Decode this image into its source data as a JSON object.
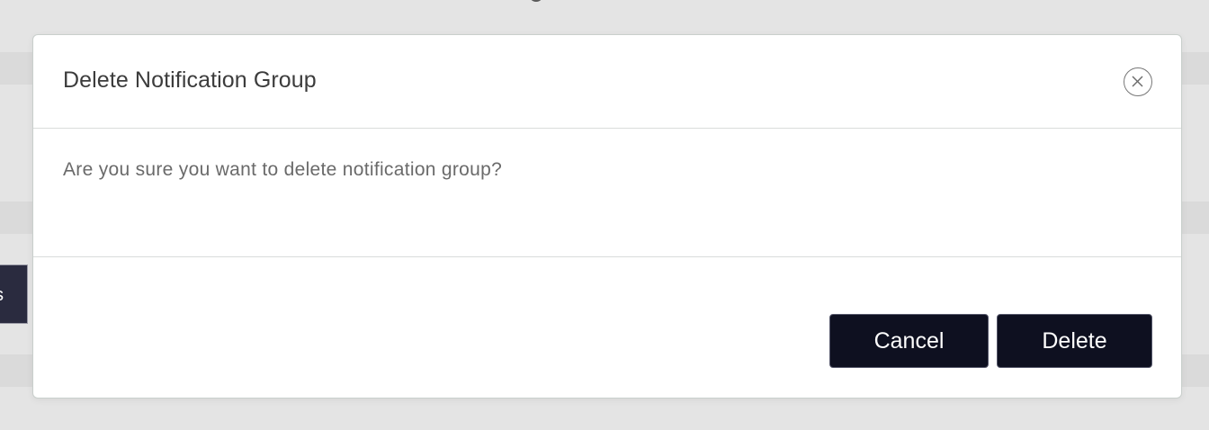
{
  "background": {
    "side_button_label": "s"
  },
  "dialog": {
    "title": "Delete Notification Group",
    "message": "Are you sure you want to delete notification group?",
    "close_icon": "close-circle-icon",
    "cancel_label": "Cancel",
    "delete_label": "Delete"
  },
  "colors": {
    "button_bg": "#0e1020",
    "button_text": "#ffffff",
    "overlay_bg": "#e4e4e4",
    "dialog_bg": "#ffffff"
  }
}
